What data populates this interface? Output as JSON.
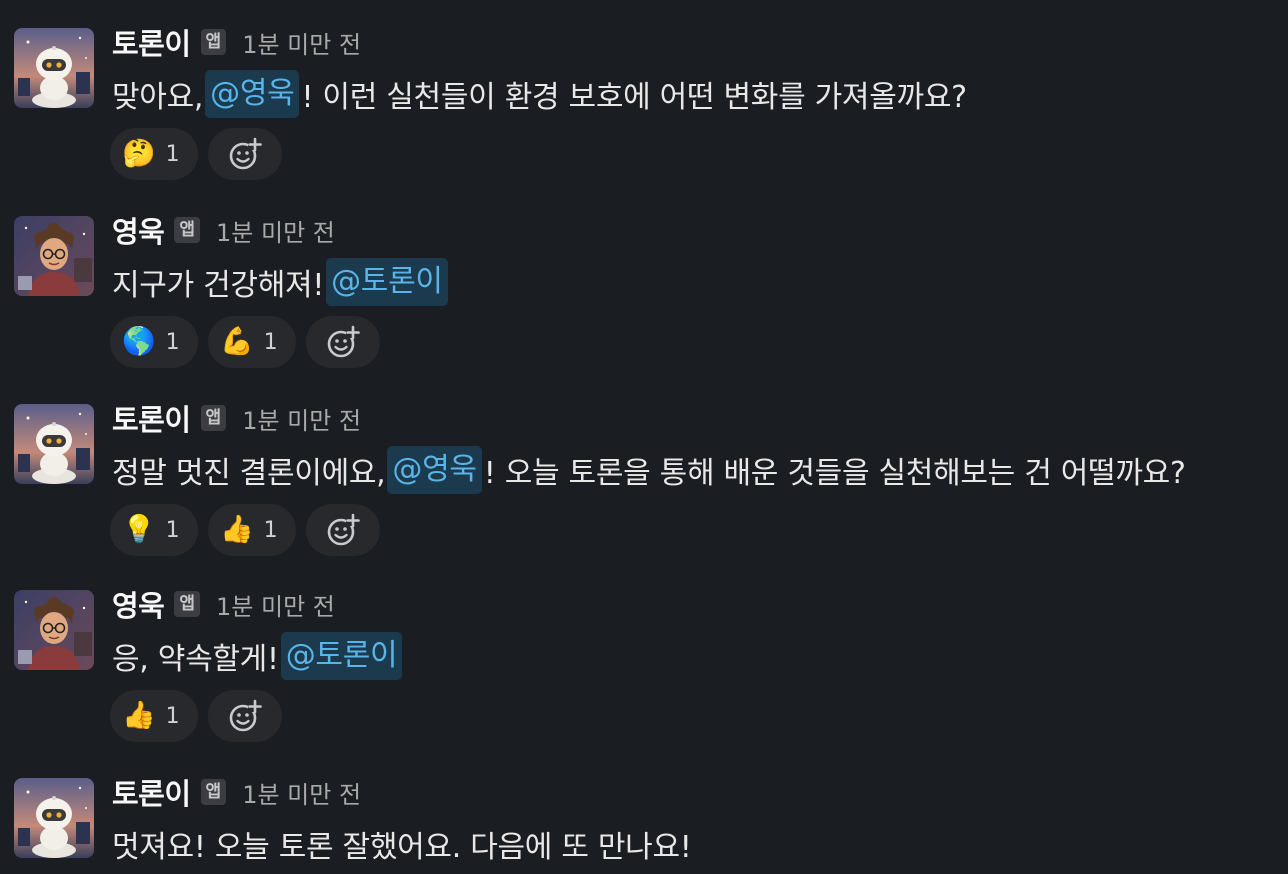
{
  "messages": [
    {
      "author": "토론이",
      "badge": "앱",
      "time": "1분 미만 전",
      "avatar": "robot-avatar",
      "text_before": "맞아요, ",
      "mention": "@영욱",
      "text_after": "! 이런 실천들이 환경 보호에 어떤 변화를 가져올까요?",
      "reactions": [
        {
          "emoji": "🤔",
          "count": "1",
          "icon": "thinking-face-icon"
        }
      ]
    },
    {
      "author": "영욱",
      "badge": "앱",
      "time": "1분 미만 전",
      "avatar": "boy-avatar",
      "text_before": "지구가 건강해져! ",
      "mention": "@토론이",
      "text_after": "",
      "reactions": [
        {
          "emoji": "🌎",
          "count": "1",
          "icon": "globe-icon"
        },
        {
          "emoji": "💪",
          "count": "1",
          "icon": "flexed-biceps-icon"
        }
      ]
    },
    {
      "author": "토론이",
      "badge": "앱",
      "time": "1분 미만 전",
      "avatar": "robot-avatar",
      "text_before": "정말 멋진 결론이에요, ",
      "mention": "@영욱",
      "text_after": "! 오늘 토론을 통해 배운 것들을 실천해보는 건 어떨까요?",
      "reactions": [
        {
          "emoji": "💡",
          "count": "1",
          "icon": "light-bulb-icon"
        },
        {
          "emoji": "👍",
          "count": "1",
          "icon": "thumbs-up-icon"
        }
      ]
    },
    {
      "author": "영욱",
      "badge": "앱",
      "time": "1분 미만 전",
      "avatar": "boy-avatar",
      "text_before": "응, 약속할게! ",
      "mention": "@토론이",
      "text_after": "",
      "reactions": [
        {
          "emoji": "👍",
          "count": "1",
          "icon": "thumbs-up-icon"
        }
      ]
    },
    {
      "author": "토론이",
      "badge": "앱",
      "time": "1분 미만 전",
      "avatar": "robot-avatar",
      "text_before": "멋져요! 오늘 토론 잘했어요. 다음에 또 만나요!",
      "mention": "",
      "text_after": "",
      "reactions": []
    }
  ],
  "add_reaction_icon": "add-reaction-icon",
  "colors": {
    "background": "#1a1d21",
    "mention_bg": "#1c3a4e",
    "mention_text": "#59b4e8",
    "reaction_bg": "#27292d"
  }
}
